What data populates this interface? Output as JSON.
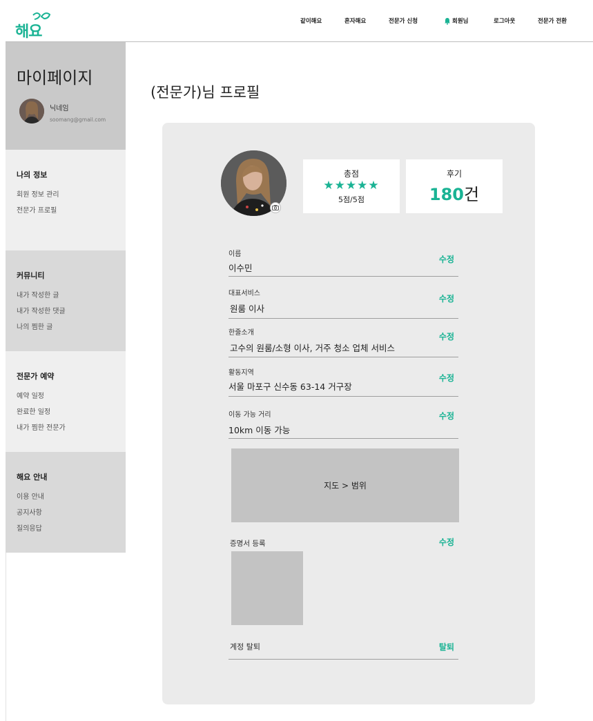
{
  "header": {
    "logo_text": "해요",
    "logo_mark": "ㅋ",
    "nav": [
      {
        "label": "같이해요"
      },
      {
        "label": "혼자해요"
      },
      {
        "label": "전문가 신청"
      },
      {
        "label": "회원님"
      },
      {
        "label": "로그아웃"
      },
      {
        "label": "전문가 전환"
      }
    ],
    "accent": "#1ab394"
  },
  "sidebar": {
    "title": "마이페이지",
    "nickname": "닉네임",
    "email": "soomang@gmail.com",
    "sections": [
      {
        "heading": "나의 정보",
        "items": [
          "회원 정보 관리",
          "전문가 프로필"
        ]
      },
      {
        "heading": "커뮤니티",
        "items": [
          "내가 작성한 글",
          "내가 작성한 댓글",
          "나의 찜한 글"
        ]
      },
      {
        "heading": "전문가 예약",
        "items": [
          "예약 일정",
          "완료한 일정",
          "내가 찜한 전문가"
        ]
      },
      {
        "heading": "해요 안내",
        "items": [
          "이용 안내",
          "공지사항",
          "질의응답"
        ]
      }
    ]
  },
  "main": {
    "page_title": "(전문가)님 프로필",
    "rating": {
      "label": "총점",
      "stars": "★★★★★",
      "score_text": "5점/5점",
      "value": 5,
      "max": 5
    },
    "reviews": {
      "label": "후기",
      "count": "180",
      "unit": "건"
    },
    "fields": [
      {
        "label": "이름",
        "value": "이수민",
        "action": "수정"
      },
      {
        "label": "대표서비스",
        "value": "원룸 이사",
        "action": "수정"
      },
      {
        "label": "한줄소개",
        "value": "고수의 원룸/소형 이사, 거주 청소 업체 서비스",
        "action": "수정"
      },
      {
        "label": "활동지역",
        "value": "서울 마포구 신수동 63-14 거구장",
        "action": "수정"
      },
      {
        "label": "이동 가능 거리",
        "value": "10km 이동 가능",
        "action": "수정"
      }
    ],
    "map_placeholder": "지도 > 범위",
    "certificate": {
      "label": "증명서 등록",
      "action": "수정"
    },
    "withdraw": {
      "label": "계정 탈퇴",
      "action": "탈퇴"
    }
  }
}
